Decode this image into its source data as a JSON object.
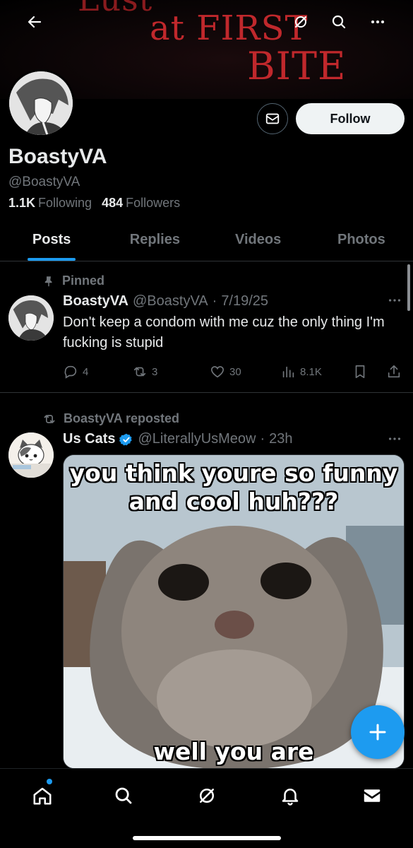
{
  "banner": {
    "line_top": "Lust",
    "line_mid": "at FIRST",
    "line_bot": "BITE"
  },
  "profile": {
    "display_name": "BoastyVA",
    "handle": "@BoastyVA",
    "following_count": "1.1K",
    "following_label": "Following",
    "followers_count": "484",
    "followers_label": "Followers",
    "follow_label": "Follow"
  },
  "tabs": [
    {
      "label": "Posts"
    },
    {
      "label": "Replies"
    },
    {
      "label": "Videos"
    },
    {
      "label": "Photos"
    }
  ],
  "posts": [
    {
      "context": "Pinned",
      "name": "BoastyVA",
      "handle": "@BoastyVA",
      "dot": "·",
      "date": "7/19/25",
      "text": "Don't keep a condom with me cuz the only thing I'm fucking is stupid",
      "replies": "4",
      "reposts": "3",
      "likes": "30",
      "views": "8.1K"
    },
    {
      "context": "BoastyVA reposted",
      "name": "Us Cats",
      "handle": "@LiterallyUsMeow",
      "dot": "·",
      "date": "23h",
      "media_caption_top": "you think youre so funny and cool huh???",
      "media_caption_bottom": "well you are"
    }
  ],
  "colors": {
    "accent": "#1d9bf0",
    "muted": "#71767b",
    "text": "#e7e9ea",
    "background": "#000000"
  },
  "icons": {
    "back": "arrow-left-icon",
    "grok": "grok-icon",
    "search": "search-icon",
    "more": "more-dots-icon",
    "message": "envelope-icon",
    "pin": "pin-icon",
    "repost": "repost-icon",
    "compose": "plus-icon"
  }
}
